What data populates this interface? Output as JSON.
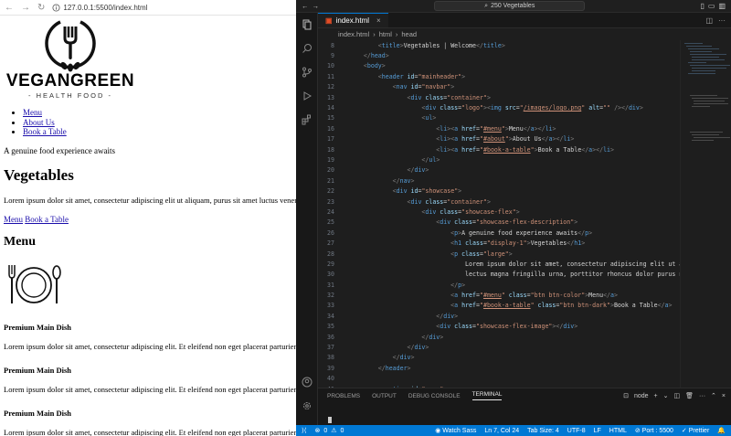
{
  "browser": {
    "url": "127.0.0.1:5500/index.html",
    "brand": "VEGANGREEN",
    "subtitle": "- HEALTH FOOD -",
    "nav": [
      "Menu",
      "About Us",
      "Book a Table"
    ],
    "tagline": "A genuine food experience awaits",
    "heading": "Vegetables",
    "intro": "Lorem ipsum dolor sit amet, consectetur adipiscing elit ut aliquam, purus sit amet luctus venenatis",
    "links": [
      "Menu",
      "Book a Table"
    ],
    "menu_heading": "Menu",
    "dishes": [
      {
        "title": "Premium Main Dish",
        "text": "Lorem ipsum dolor sit amet, consectetur adipiscing elit. Et eleifend non eget placerat parturient"
      },
      {
        "title": "Premium Main Dish",
        "text": "Lorem ipsum dolor sit amet, consectetur adipiscing elit. Et eleifend non eget placerat parturient"
      },
      {
        "title": "Premium Main Dish",
        "text": "Lorem ipsum dolor sit amet, consectetur adipiscing elit. Et eleifend non eget placerat parturient"
      }
    ]
  },
  "vscode": {
    "search": "250 Vegetables",
    "tab": "index.html",
    "breadcrumbs": [
      "index.html",
      "html",
      "head"
    ],
    "code_lines": [
      {
        "n": "8",
        "html": "        <span class='b'>&lt;</span><span class='t'>title</span><span class='b'>&gt;</span><span class='tx'>Vegetables | Welcome</span><span class='b'>&lt;/</span><span class='t'>title</span><span class='b'>&gt;</span>"
      },
      {
        "n": "9",
        "html": "    <span class='b'>&lt;/</span><span class='t'>head</span><span class='b'>&gt;</span>"
      },
      {
        "n": "10",
        "html": "    <span class='b'>&lt;</span><span class='t'>body</span><span class='b'>&gt;</span>"
      },
      {
        "n": "11",
        "html": "        <span class='b'>&lt;</span><span class='t'>header</span> <span class='a'>id</span>=<span class='s'>\"mainheader\"</span><span class='b'>&gt;</span>"
      },
      {
        "n": "12",
        "html": "            <span class='b'>&lt;</span><span class='t'>nav</span> <span class='a'>id</span>=<span class='s'>\"navbar\"</span><span class='b'>&gt;</span>"
      },
      {
        "n": "13",
        "html": "                <span class='b'>&lt;</span><span class='t'>div</span> <span class='a'>class</span>=<span class='s'>\"container\"</span><span class='b'>&gt;</span>"
      },
      {
        "n": "14",
        "html": "                    <span class='b'>&lt;</span><span class='t'>div</span> <span class='a'>class</span>=<span class='s'>\"logo\"</span><span class='b'>&gt;&lt;</span><span class='t'>img</span> <span class='a'>src</span>=<span class='s'>\"</span><span class='u'>/images/logo.png</span><span class='s'>\"</span> <span class='a'>alt</span>=<span class='s'>\"\"</span> <span class='b'>/&gt;&lt;/</span><span class='t'>div</span><span class='b'>&gt;</span>"
      },
      {
        "n": "15",
        "html": "                    <span class='b'>&lt;</span><span class='t'>ul</span><span class='b'>&gt;</span>"
      },
      {
        "n": "16",
        "html": "                        <span class='b'>&lt;</span><span class='t'>li</span><span class='b'>&gt;&lt;</span><span class='t'>a</span> <span class='a'>href</span>=<span class='s'>\"</span><span class='u'>#menu</span><span class='s'>\"</span><span class='b'>&gt;</span><span class='tx'>Menu</span><span class='b'>&lt;/</span><span class='t'>a</span><span class='b'>&gt;&lt;/</span><span class='t'>li</span><span class='b'>&gt;</span>"
      },
      {
        "n": "17",
        "html": "                        <span class='b'>&lt;</span><span class='t'>li</span><span class='b'>&gt;&lt;</span><span class='t'>a</span> <span class='a'>href</span>=<span class='s'>\"</span><span class='u'>#about</span><span class='s'>\"</span><span class='b'>&gt;</span><span class='tx'>About Us</span><span class='b'>&lt;/</span><span class='t'>a</span><span class='b'>&gt;&lt;/</span><span class='t'>li</span><span class='b'>&gt;</span>"
      },
      {
        "n": "18",
        "html": "                        <span class='b'>&lt;</span><span class='t'>li</span><span class='b'>&gt;&lt;</span><span class='t'>a</span> <span class='a'>href</span>=<span class='s'>\"</span><span class='u'>#book-a-table</span><span class='s'>\"</span><span class='b'>&gt;</span><span class='tx'>Book a Table</span><span class='b'>&lt;/</span><span class='t'>a</span><span class='b'>&gt;&lt;/</span><span class='t'>li</span><span class='b'>&gt;</span>"
      },
      {
        "n": "19",
        "html": "                    <span class='b'>&lt;/</span><span class='t'>ul</span><span class='b'>&gt;</span>"
      },
      {
        "n": "20",
        "html": "                <span class='b'>&lt;/</span><span class='t'>div</span><span class='b'>&gt;</span>"
      },
      {
        "n": "21",
        "html": "            <span class='b'>&lt;/</span><span class='t'>nav</span><span class='b'>&gt;</span>"
      },
      {
        "n": "22",
        "html": "            <span class='b'>&lt;</span><span class='t'>div</span> <span class='a'>id</span>=<span class='s'>\"showcase\"</span><span class='b'>&gt;</span>"
      },
      {
        "n": "23",
        "html": "                <span class='b'>&lt;</span><span class='t'>div</span> <span class='a'>class</span>=<span class='s'>\"container\"</span><span class='b'>&gt;</span>"
      },
      {
        "n": "24",
        "html": "                    <span class='b'>&lt;</span><span class='t'>div</span> <span class='a'>class</span>=<span class='s'>\"showcase-flex\"</span><span class='b'>&gt;</span>"
      },
      {
        "n": "25",
        "html": "                        <span class='b'>&lt;</span><span class='t'>div</span> <span class='a'>class</span>=<span class='s'>\"showcase-flex-description\"</span><span class='b'>&gt;</span>"
      },
      {
        "n": "26",
        "html": "                            <span class='b'>&lt;</span><span class='t'>p</span><span class='b'>&gt;</span><span class='tx'>A genuine food experience awaits</span><span class='b'>&lt;/</span><span class='t'>p</span><span class='b'>&gt;</span>"
      },
      {
        "n": "27",
        "html": "                            <span class='b'>&lt;</span><span class='t'>h1</span> <span class='a'>class</span>=<span class='s'>\"display-1\"</span><span class='b'>&gt;</span><span class='tx'>Vegetables</span><span class='b'>&lt;/</span><span class='t'>h1</span><span class='b'>&gt;</span>"
      },
      {
        "n": "28",
        "html": "                            <span class='b'>&lt;</span><span class='t'>p</span> <span class='a'>class</span>=<span class='s'>\"large\"</span><span class='b'>&gt;</span>"
      },
      {
        "n": "29",
        "html": "                                <span class='tx'>Lorem ipsum dolor sit amet, consectetur adipiscing elit ut al</span>"
      },
      {
        "n": "30",
        "html": "                                <span class='tx'>lectus magna fringilla urna, porttitor rhoncus dolor purus no</span>"
      },
      {
        "n": "31",
        "html": "                            <span class='b'>&lt;/</span><span class='t'>p</span><span class='b'>&gt;</span>"
      },
      {
        "n": "32",
        "html": "                            <span class='b'>&lt;</span><span class='t'>a</span> <span class='a'>href</span>=<span class='s'>\"</span><span class='u'>#menu</span><span class='s'>\"</span> <span class='a'>class</span>=<span class='s'>\"btn btn-color\"</span><span class='b'>&gt;</span><span class='tx'>Menu</span><span class='b'>&lt;/</span><span class='t'>a</span><span class='b'>&gt;</span>"
      },
      {
        "n": "33",
        "html": "                            <span class='b'>&lt;</span><span class='t'>a</span> <span class='a'>href</span>=<span class='s'>\"</span><span class='u'>#book-a-table</span><span class='s'>\"</span> <span class='a'>class</span>=<span class='s'>\"btn btn-dark\"</span><span class='b'>&gt;</span><span class='tx'>Book a Table</span><span class='b'>&lt;/</span><span class='t'>a</span><span class='b'>&gt;</span>"
      },
      {
        "n": "34",
        "html": "                        <span class='b'>&lt;/</span><span class='t'>div</span><span class='b'>&gt;</span>"
      },
      {
        "n": "35",
        "html": "                        <span class='b'>&lt;</span><span class='t'>div</span> <span class='a'>class</span>=<span class='s'>\"showcase-flex-image\"</span><span class='b'>&gt;&lt;/</span><span class='t'>div</span><span class='b'>&gt;</span>"
      },
      {
        "n": "36",
        "html": "                    <span class='b'>&lt;/</span><span class='t'>div</span><span class='b'>&gt;</span>"
      },
      {
        "n": "37",
        "html": "                <span class='b'>&lt;/</span><span class='t'>div</span><span class='b'>&gt;</span>"
      },
      {
        "n": "38",
        "html": "            <span class='b'>&lt;/</span><span class='t'>div</span><span class='b'>&gt;</span>"
      },
      {
        "n": "39",
        "html": "        <span class='b'>&lt;/</span><span class='t'>header</span><span class='b'>&gt;</span>"
      },
      {
        "n": "40",
        "html": ""
      },
      {
        "n": "41",
        "html": "        <span class='b'>&lt;</span><span class='t'>section</span> <span class='a'>id</span>=<span class='s'>\"menu\"</span><span class='b'>&gt;</span>"
      },
      {
        "n": "42",
        "html": "            <span class='b'>&lt;</span><span class='t'>div</span> <span class='a'>class</span>=<span class='s'>\"container\"</span><span class='b'>&gt;</span>"
      },
      {
        "n": "43",
        "html": "                <span class='b'>&lt;</span><span class='t'>h2</span><span class='b'>&gt;</span><span class='tx'>Menu</span><span class='b'>&lt;/</span><span class='t'>h2</span><span class='b'>&gt;</span>"
      },
      {
        "n": "44",
        "html": "                <span class='b'>&lt;</span><span class='t'>img</span> <span class='a'>class</span>=<span class='s'>\"icon\"</span> <span class='a'>src</span>=<span class='s'>\"</span><span class='u'>/images/icon-1.png</span><span class='s'>\"</span> <span class='a'>alt</span>=<span class='s'>\"\"</span> <span class='b'>/&gt;</span>"
      },
      {
        "n": "45",
        "html": "                <span class='b'>&lt;</span><span class='t'>div</span> <span class='a'>class</span>=<span class='s'>\"menu-flex\"</span><span class='b'>&gt;</span>"
      },
      {
        "n": "46",
        "html": "                    <span class='b'>&lt;</span><span class='t'>div</span> <span class='a'>class</span>=<span class='s'>\"menu-flex-box\"</span><span class='b'>&gt;</span>"
      },
      {
        "n": "47",
        "html": "                        <span class='b'>&lt;</span><span class='t'>h4</span><span class='b'>&gt;</span><span class='tx'>Premium Main Dish</span><span class='b'>&lt;/</span><span class='t'>h4</span><span class='b'>&gt;</span>"
      }
    ],
    "panel_tabs": [
      "PROBLEMS",
      "OUTPUT",
      "DEBUG CONSOLE",
      "TERMINAL"
    ],
    "terminal_name": "node",
    "status": {
      "errors": "0",
      "warnings": "0",
      "watch_sass": "Watch Sass",
      "position": "Ln 7, Col 24",
      "tab_size": "Tab Size: 4",
      "encoding": "UTF-8",
      "eol": "LF",
      "language": "HTML",
      "port": "Port : 5500",
      "prettier": "Prettier"
    }
  }
}
